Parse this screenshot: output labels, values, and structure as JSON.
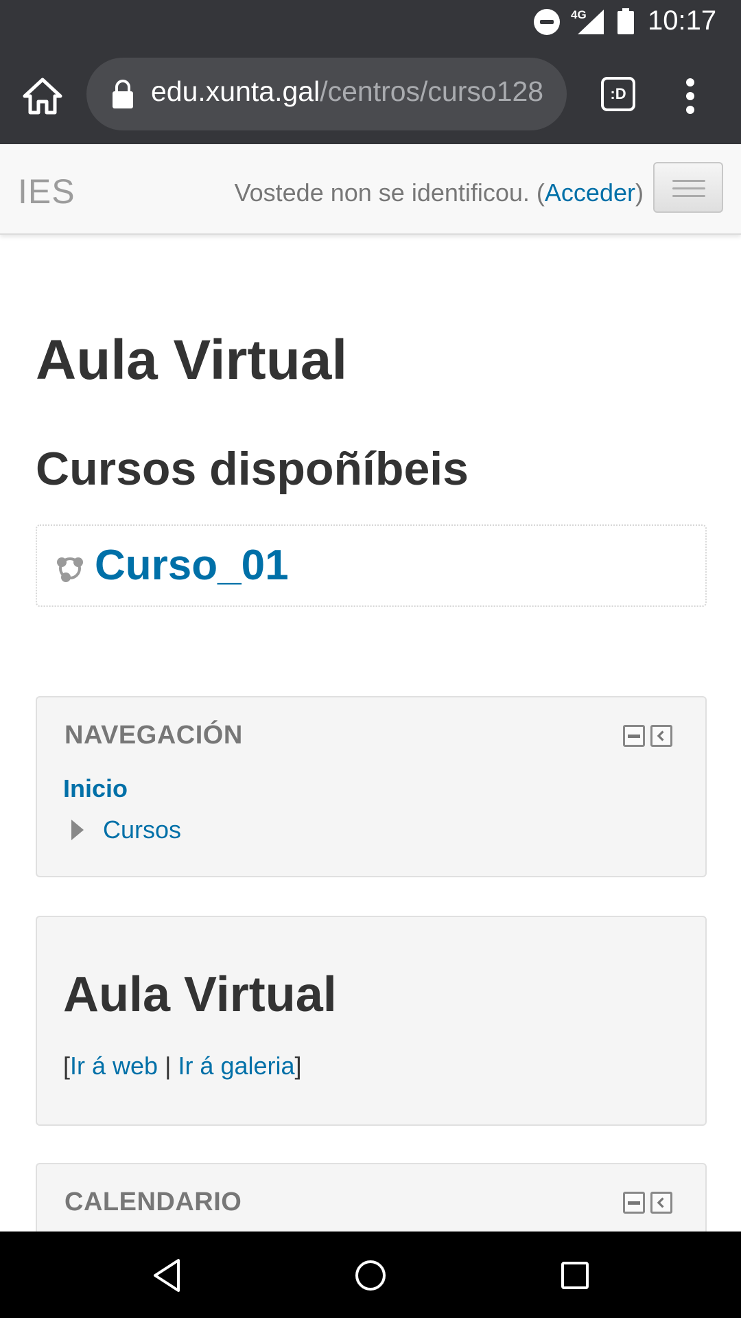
{
  "status_bar": {
    "network": "4G",
    "time": "10:17"
  },
  "browser": {
    "url_host": "edu.xunta.gal",
    "url_path": "/centros/curso128",
    "tabs_label": ":D"
  },
  "site_nav": {
    "brand": "IES",
    "login_prefix": "Vostede non se identificou. (",
    "login_link": "Acceder",
    "login_suffix": ")"
  },
  "main": {
    "page_title": "Aula Virtual",
    "section_title": "Cursos dispoñíbeis",
    "courses": [
      {
        "name": "Curso_01"
      }
    ]
  },
  "blocks": {
    "navigation": {
      "title": "NAVEGACIÓN",
      "home_link": "Inicio",
      "courses_link": "Cursos"
    },
    "aula": {
      "title": "Aula Virtual",
      "bracket_open": "[",
      "link_web": "Ir á web",
      "separator": " | ",
      "link_gallery": "Ir á galeria",
      "bracket_close": "]"
    },
    "calendar": {
      "title": "CALENDARIO"
    }
  },
  "colors": {
    "link": "#0070a8",
    "chrome_dark": "#35363a",
    "block_bg": "#f5f5f5",
    "heading": "#333333"
  },
  "icons": {
    "home": "home-icon",
    "lock": "lock-icon",
    "menu": "more-vert-icon",
    "hamburger": "hamburger-icon",
    "course": "course-icon",
    "expand": "triangle-right-icon"
  }
}
